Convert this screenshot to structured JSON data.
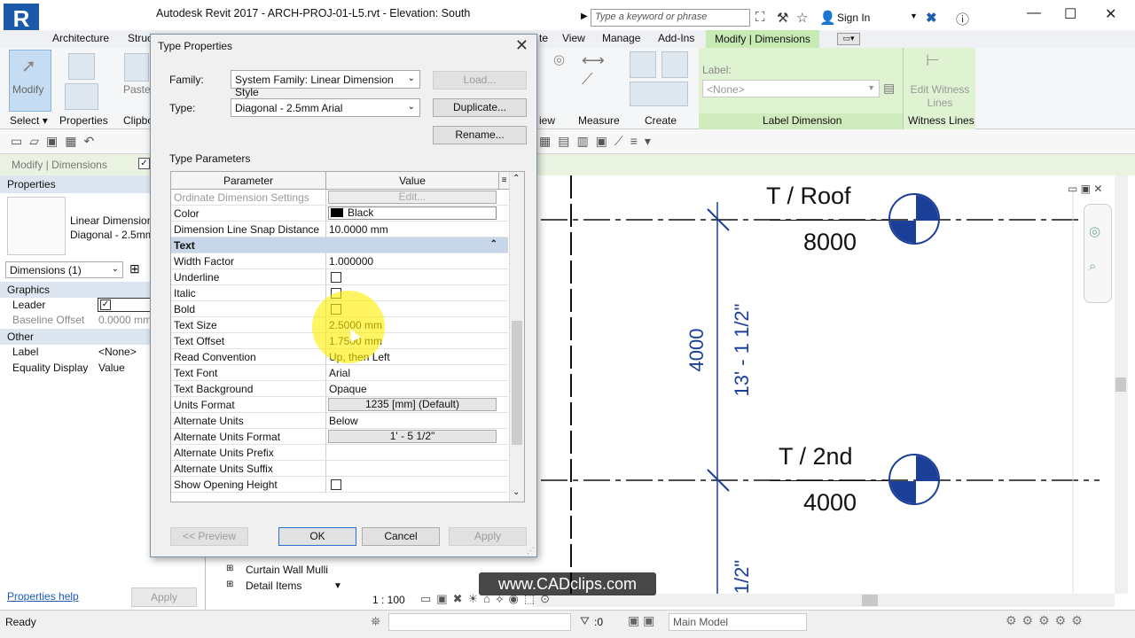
{
  "window": {
    "app_letter": "R",
    "title": "Autodesk Revit 2017 -      ARCH-PROJ-01-L5.rvt - Elevation: South",
    "search_placeholder": "Type a keyword or phrase",
    "sign_in": "Sign In",
    "minimize": "—",
    "maximize": "☐",
    "close": "✕"
  },
  "ribbon_tabs": [
    "Architecture",
    "Struc",
    "te",
    "View",
    "Manage",
    "Add-Ins",
    "Modify | Dimensions"
  ],
  "ribbon": {
    "modify_label": "Modify",
    "paste_label": "Paste",
    "select_label": "Select",
    "properties_label": "Properties",
    "clipboard_label": "Clipbo",
    "view_label": "iew",
    "measure_label": "Measure",
    "create_label": "Create",
    "label_field_label": "Label:",
    "label_field_value": "<None>",
    "label_dimension_label": "Label Dimension",
    "edit_witness_label": "Edit Witness Lines",
    "witness_lines_label": "Witness Lines"
  },
  "options_bar": {
    "context_label": "Modify | Dimensions"
  },
  "properties": {
    "title": "Properties",
    "type_line1": "Linear Dimension",
    "type_line2": "Diagonal - 2.5mm",
    "selector": "Dimensions (1)",
    "sections": {
      "graphics": "Graphics",
      "other": "Other"
    },
    "rows": {
      "leader": "Leader",
      "baseline_offset": "Baseline Offset",
      "baseline_value": "0.0000 mm",
      "label": "Label",
      "label_value": "<None>",
      "equality_display": "Equality Display",
      "equality_value": "Value"
    },
    "help_link": "Properties help",
    "apply": "Apply"
  },
  "browser": {
    "item1": "Curtain Wall Mulli",
    "item2": "Detail Items"
  },
  "drawing": {
    "level1_name": "T / Roof",
    "level1_value": "8000",
    "level2_name": "T / 2nd",
    "level2_value": "4000",
    "dim_vertical_mm": "4000",
    "dim_vertical_imperial": "13' - 1 1/2\"",
    "dim_vertical_partial": "1/2\""
  },
  "status": {
    "ready": "Ready",
    "scale": "1 : 100",
    "selection_count": ":0",
    "model": "Main Model"
  },
  "watermark": "www.CADclips.com",
  "dialog": {
    "title": "Type Properties",
    "family_label": "Family:",
    "family_value": "System Family: Linear Dimension Style",
    "type_label": "Type:",
    "type_value": "Diagonal - 2.5mm Arial",
    "load_button": "Load...",
    "duplicate_button": "Duplicate...",
    "rename_button": "Rename...",
    "type_parameters_label": "Type Parameters",
    "col_parameter": "Parameter",
    "col_value": "Value",
    "rows": [
      {
        "param": "Ordinate Dimension Settings",
        "kind": "button-disabled",
        "value": "Edit..."
      },
      {
        "param": "Color",
        "kind": "color",
        "value": "Black"
      },
      {
        "param": "Dimension Line Snap Distance",
        "kind": "text",
        "value": "10.0000 mm"
      },
      {
        "param": "Text",
        "kind": "group",
        "value": ""
      },
      {
        "param": "Width Factor",
        "kind": "text",
        "value": "1.000000"
      },
      {
        "param": "Underline",
        "kind": "check",
        "value": ""
      },
      {
        "param": "Italic",
        "kind": "check",
        "value": ""
      },
      {
        "param": "Bold",
        "kind": "check",
        "value": ""
      },
      {
        "param": "Text Size",
        "kind": "text",
        "value": "2.5000 mm"
      },
      {
        "param": "Text Offset",
        "kind": "text",
        "value": "1.7500 mm"
      },
      {
        "param": "Read Convention",
        "kind": "text",
        "value": "Up, then Left"
      },
      {
        "param": "Text Font",
        "kind": "text",
        "value": "Arial"
      },
      {
        "param": "Text Background",
        "kind": "text",
        "value": "Opaque"
      },
      {
        "param": "Units Format",
        "kind": "button",
        "value": "1235 [mm] (Default)"
      },
      {
        "param": "Alternate Units",
        "kind": "text",
        "value": "Below"
      },
      {
        "param": "Alternate Units Format",
        "kind": "button",
        "value": "1' - 5 1/2\""
      },
      {
        "param": "Alternate Units Prefix",
        "kind": "text",
        "value": ""
      },
      {
        "param": "Alternate Units Suffix",
        "kind": "text",
        "value": ""
      },
      {
        "param": "Show Opening Height",
        "kind": "check",
        "value": ""
      }
    ],
    "preview_button": "<< Preview",
    "ok_button": "OK",
    "cancel_button": "Cancel",
    "apply_button": "Apply"
  },
  "colors": {
    "accent_blue": "#1b3f99",
    "ribbon_green": "#c8eab4",
    "highlight_yellow": "#ffee00"
  }
}
